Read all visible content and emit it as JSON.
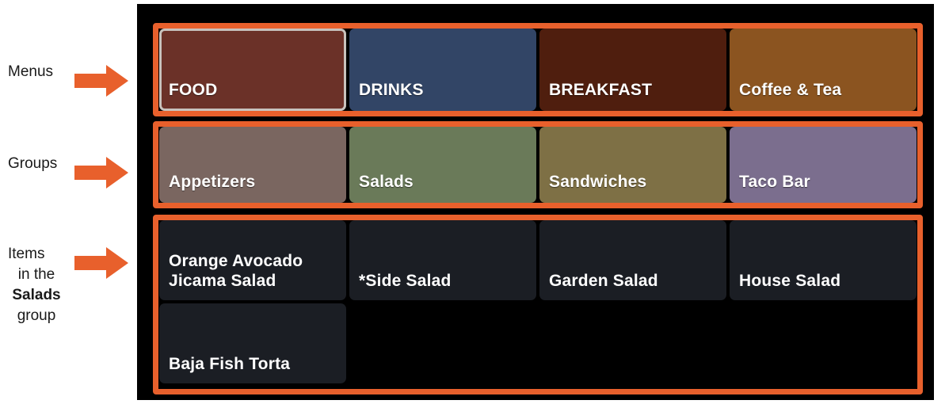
{
  "annotations": [
    {
      "id": "menus",
      "label": "Menus",
      "sublines": [],
      "arrow": "right-arrow-icon"
    },
    {
      "id": "groups",
      "label": "Groups",
      "sublines": [],
      "arrow": "right-arrow-icon"
    },
    {
      "id": "items",
      "label": "Items",
      "sublines": [
        {
          "text": "in the",
          "bold": false
        },
        {
          "text": "Salads",
          "bold": true
        },
        {
          "text": "group",
          "bold": false
        }
      ],
      "arrow": "right-arrow-icon"
    }
  ],
  "highlight_color": "#E8602C",
  "panel_background": "#000000",
  "pos": {
    "menus": {
      "row_label": "Menus",
      "buttons": [
        {
          "label": "FOOD",
          "color": "#6B3128",
          "selected": true
        },
        {
          "label": "DRINKS",
          "color": "#324566",
          "selected": false
        },
        {
          "label": "BREAKFAST",
          "color": "#4F1E0E",
          "selected": false
        },
        {
          "label": "Coffee & Tea",
          "color": "#8B5420",
          "selected": false
        }
      ]
    },
    "groups": {
      "row_label": "Groups",
      "buttons": [
        {
          "label": "Appetizers",
          "color": "#7A6660",
          "selected": false
        },
        {
          "label": "Salads",
          "color": "#6A7A59",
          "selected": false
        },
        {
          "label": "Sandwiches",
          "color": "#7E7045",
          "selected": false
        },
        {
          "label": "Taco Bar",
          "color": "#7B6E8E",
          "selected": false
        }
      ]
    },
    "items": {
      "row_label": "Items",
      "buttons": [
        {
          "label": "Orange Avocado\nJicama Salad",
          "color": "#1b1e24"
        },
        {
          "label": "*Side Salad",
          "color": "#1b1e24"
        },
        {
          "label": "Garden Salad",
          "color": "#1b1e24"
        },
        {
          "label": "House Salad",
          "color": "#1b1e24"
        },
        {
          "label": "Baja Fish Torta",
          "color": "#1b1e24"
        }
      ]
    }
  }
}
